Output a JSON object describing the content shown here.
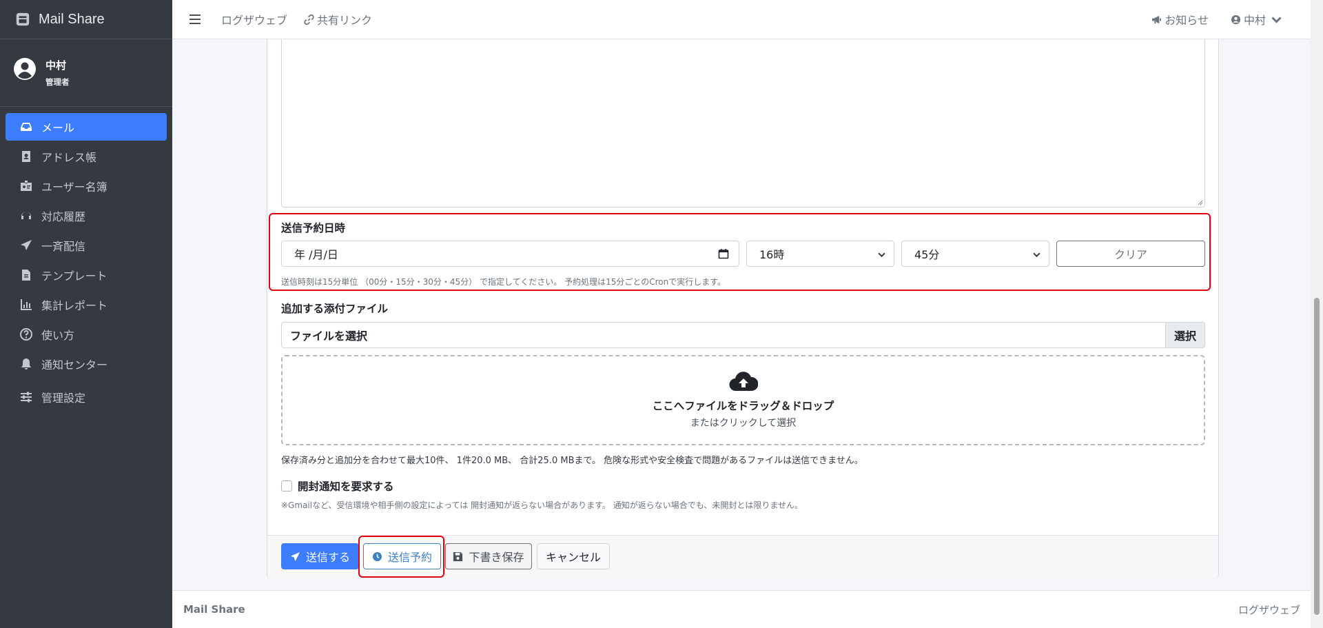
{
  "app": {
    "brand": "Mail Share"
  },
  "user": {
    "name": "中村",
    "role": "管理者"
  },
  "sidebar": {
    "items": [
      {
        "label": "メール",
        "icon": "inbox-icon",
        "active": true
      },
      {
        "label": "アドレス帳",
        "icon": "address-book-icon"
      },
      {
        "label": "ユーザー名簿",
        "icon": "id-badge-icon"
      },
      {
        "label": "対応履歴",
        "icon": "headset-icon"
      },
      {
        "label": "一斉配信",
        "icon": "paper-plane-icon"
      },
      {
        "label": "テンプレート",
        "icon": "file-icon"
      },
      {
        "label": "集計レポート",
        "icon": "chart-icon"
      },
      {
        "label": "使い方",
        "icon": "question-circle-icon"
      },
      {
        "label": "通知センター",
        "icon": "bell-icon"
      },
      {
        "label": "管理設定",
        "icon": "sliders-icon"
      }
    ]
  },
  "topbar": {
    "links": [
      "ログザウェブ",
      "共有リンク"
    ],
    "notice": "お知らせ",
    "user": "中村"
  },
  "schedule": {
    "label": "送信予約日時",
    "date_placeholder": "年 /月/日",
    "hour": "16時",
    "minute": "45分",
    "clear": "クリア",
    "help": "送信時刻は15分単位 （00分・15分・30分・45分） で指定してください。 予約処理は15分ごとのCronで実行します。"
  },
  "attachments": {
    "label": "追加する添付ファイル",
    "input": "ファイルを選択",
    "button": "選択",
    "drop_title": "ここへファイルをドラッグ＆ドロップ",
    "drop_sub": "またはクリックして選択",
    "note": "保存済み分と追加分を合わせて最大10件、 1件20.0 MB、 合計25.0 MBまで。 危険な形式や安全検査で問題があるファイルは送信できません。"
  },
  "read_receipt": {
    "label": "開封通知を要求する",
    "note": "※Gmailなど、受信環境や相手側の設定によっては 開封通知が返らない場合があります。 通知が返らない場合でも、未開封とは限りません。"
  },
  "actions": {
    "send": "送信する",
    "schedule": "送信予約",
    "draft": "下書き保存",
    "cancel": "キャンセル"
  },
  "footer": {
    "left": "Mail Share",
    "right": "ログザウェブ"
  },
  "colors": {
    "primary": "#3d7dfb",
    "sidebar": "#343a40",
    "highlight": "#e3000f",
    "info": "#3f82c2"
  }
}
